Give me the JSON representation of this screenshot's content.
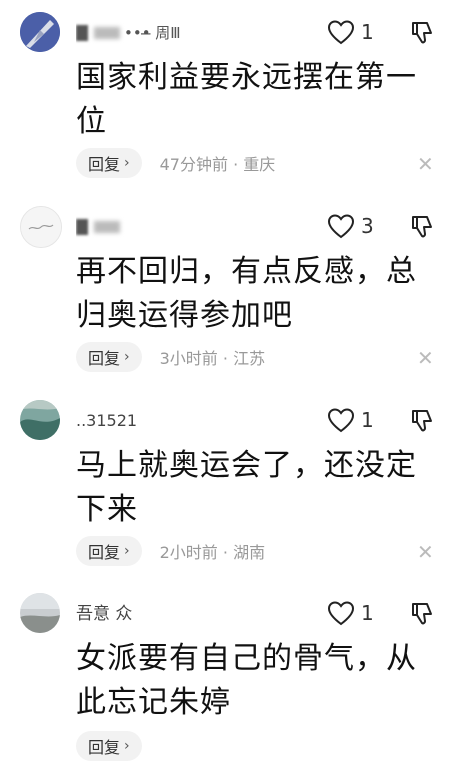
{
  "comments": [
    {
      "name": "•••̶ 周Ⅲ",
      "likes": "1",
      "text": "国家利益要永远摆在第一位",
      "reply_label": "回复",
      "time_location": "47分钟前 · 重庆"
    },
    {
      "name": "",
      "likes": "3",
      "text": "再不回归，有点反感，总归奥运得参加吧",
      "reply_label": "回复",
      "time_location": "3小时前 · 江苏"
    },
    {
      "name": "..31521",
      "likes": "1",
      "text": "马上就奥运会了，还没定下来",
      "reply_label": "回复",
      "time_location": "2小时前 · 湖南"
    },
    {
      "name": "吾意 众",
      "likes": "1",
      "text": "女派要有自己的骨气，从此忘记朱婷",
      "reply_label": "回复",
      "time_location": ""
    }
  ],
  "icons": {
    "heart": "heart-outline-icon",
    "dislike": "thumbs-down-outline-icon",
    "close": "close-icon",
    "chevron": "chevron-right-icon"
  },
  "chevron_glyph": "›",
  "close_glyph": "✕"
}
